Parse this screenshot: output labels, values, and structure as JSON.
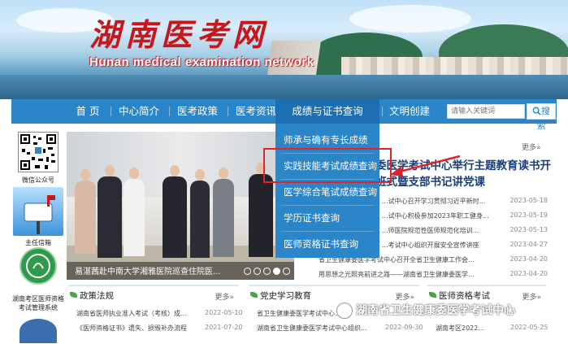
{
  "header": {
    "site_title": "湖南医考网",
    "site_subtitle": "Hunan medical examination network"
  },
  "nav": {
    "items": [
      {
        "label": "首 页"
      },
      {
        "label": "中心简介"
      },
      {
        "label": "医考政策"
      },
      {
        "label": "医考资讯"
      },
      {
        "label": "成绩与证书查询"
      },
      {
        "label": "文明创建"
      }
    ],
    "search_placeholder": "请输入关键词",
    "search_button": "搜 索"
  },
  "dropdown": {
    "items": [
      {
        "label": "师承与确有专长成绩"
      },
      {
        "label": "实践技能考试成绩查询"
      },
      {
        "label": "医学综合笔试成绩查询"
      },
      {
        "label": "学历证书查询"
      },
      {
        "label": "医师资格证书查询"
      }
    ]
  },
  "sidebar": {
    "wechat_label": "微信公众号",
    "mailbox_label": "主任信箱",
    "system_label": "湖南考区医师资格考试管理系统"
  },
  "carousel": {
    "caption": "易湛茜赴中南大学湘雅医院巡查住院医...",
    "total_slides": 5,
    "active_slide": 4
  },
  "news": {
    "more_label": "更多»",
    "headline": "委医学考试中心举行主题教育读书开班式暨支部书记讲党课",
    "rows": [
      {
        "title": "...试中心召开学习贯彻习近平新时...",
        "date": "2023-05-18"
      },
      {
        "title": "...试中心积极参加2023年职工健身...",
        "date": "2023-05-19"
      },
      {
        "title": "...师医院规范性医师规范化培训...",
        "date": "2023-05-13"
      },
      {
        "title": "...考试中心组织开展安全宣传讲座",
        "date": "2023-04-27"
      },
      {
        "title": "省卫生健康委医学考试中心召开全省卫生健康工作会...",
        "date": "2023-04-20"
      },
      {
        "title": "用思想之光照亮前进之路——湖南省卫生健康委医学...",
        "date": "2023-04-20"
      }
    ]
  },
  "panels": [
    {
      "title": "政策法规",
      "more": "更多»",
      "rows": [
        {
          "title": "湖南省医师执业准入考试（考核）成...",
          "date": "2022-05-10"
        },
        {
          "title": "《医师资格证书》遗失、损毁补办流程",
          "date": "2021-07-20"
        }
      ]
    },
    {
      "title": "党史学习教育",
      "more": "更多»",
      "rows": [
        {
          "title": "省卫生健康委医学考试中心...",
          "date": ""
        },
        {
          "title": "湖南省卫生健康委医学考试中心组织...",
          "date": "2022-09-30"
        }
      ]
    },
    {
      "title": "医师资格考试",
      "more": "更多»",
      "rows": [
        {
          "title": "",
          "date": ""
        },
        {
          "title": "湖南考区2022...",
          "date": "2022-05-25"
        }
      ]
    }
  ],
  "watermark": {
    "text": "湖南省卫生健康委医学考试中心"
  },
  "colors": {
    "nav_blue": "#2a85c9",
    "brand_red": "#c8161d",
    "highlight_red": "#e0232a",
    "headline_blue": "#1a3d7c"
  }
}
